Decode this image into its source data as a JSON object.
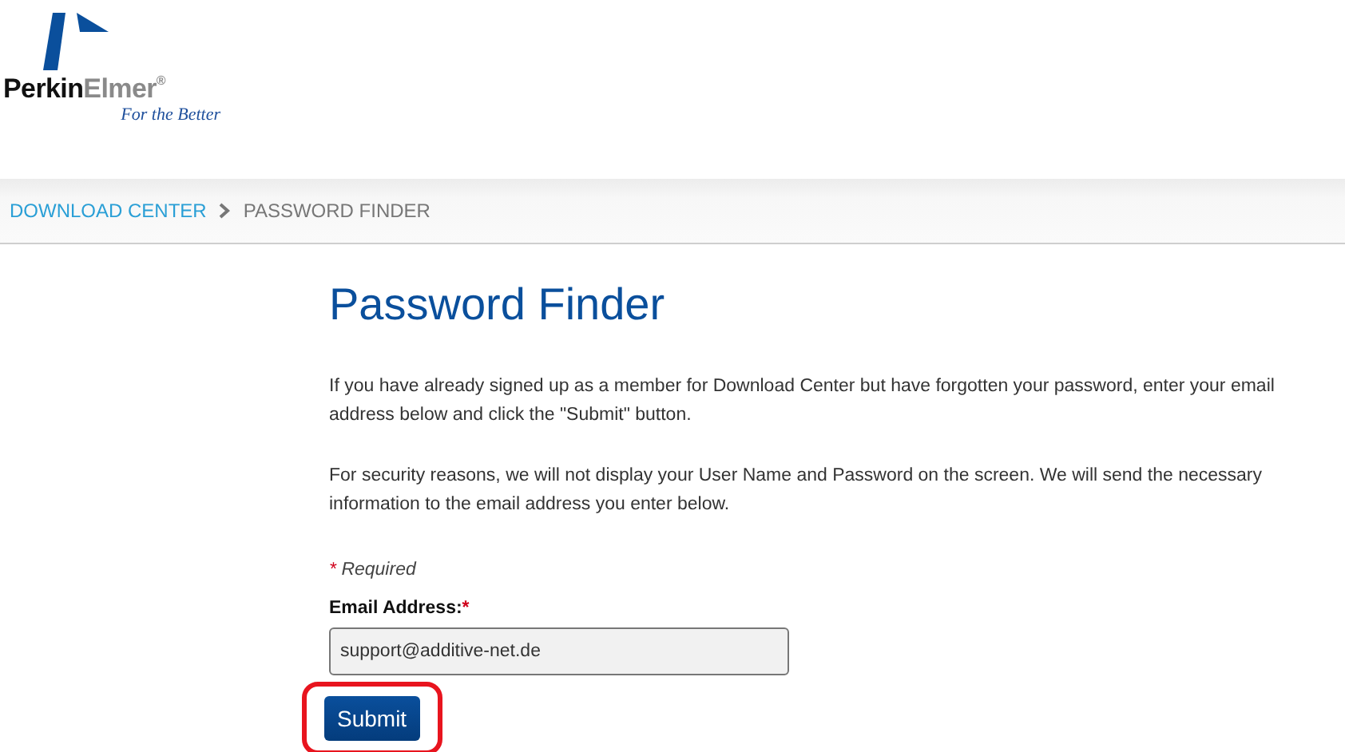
{
  "logo": {
    "brand_first": "Perkin",
    "brand_second": "Elmer",
    "registered": "®",
    "tagline": "For the Better"
  },
  "breadcrumb": [
    {
      "label": "DOWNLOAD CENTER",
      "kind": "link"
    },
    {
      "label": "PASSWORD FINDER",
      "kind": "current"
    }
  ],
  "title": "Password Finder",
  "paragraphs": [
    "If you have already signed up as a member for Download Center but have forgotten your password, enter your email address below and click the \"Submit\" button.",
    "For security reasons, we will not display your User Name and Password on the screen. We will send the necessary information to the email address you enter below."
  ],
  "required_note": {
    "mark": "*",
    "text": "Required"
  },
  "email_field": {
    "label": "Email Address:",
    "required_mark": "*",
    "value": "support@additive-net.de"
  },
  "submit_button": {
    "label": "Submit",
    "highlighted": true
  }
}
